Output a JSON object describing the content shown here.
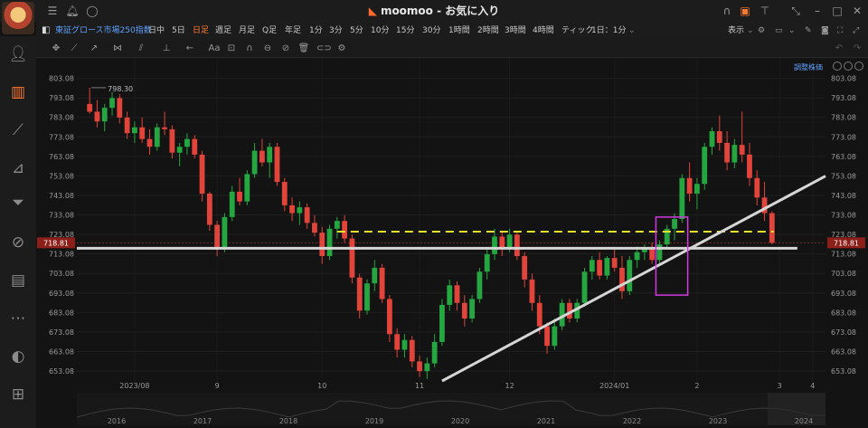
{
  "window": {
    "app_name": "moomoo",
    "title_sep": " - ",
    "subtitle": "お気に入り"
  },
  "toolbar": {
    "symbol": "東証グロース市場250指数",
    "timeframes": [
      "日中",
      "5日",
      "日足",
      "週足",
      "月足",
      "Q足",
      "年足",
      "1分",
      "3分",
      "5分",
      "10分",
      "15分",
      "30分",
      "1時間",
      "2時間",
      "3時間",
      "4時間",
      "ティック",
      "1日：1分"
    ],
    "active_timeframe": "日足",
    "display_label": "表示",
    "adjust_label": "調整株価"
  },
  "icons": {
    "titlebar": [
      "list-icon",
      "bell-icon",
      "chat-icon",
      "headset-icon",
      "lock-icon",
      "shirt-icon",
      "collapse-icon",
      "minimize-icon",
      "maximize-icon",
      "close-icon"
    ],
    "sidebar": [
      "user-icon",
      "chart-icon",
      "trend-icon",
      "report-icon",
      "filter-icon",
      "exchange-icon",
      "news-icon",
      "more-icon",
      "moomoo-icon",
      "gamepad-icon"
    ],
    "drawing_tools": [
      "crosshair-icon",
      "line-icon",
      "ray-icon",
      "pattern-icon",
      "channel-icon",
      "fib-icon",
      "arrow-icon",
      "text-icon",
      "measure-icon",
      "magnet-icon",
      "eraser-icon",
      "hide-icon",
      "trash-icon",
      "toggle-icon",
      "settings-icon"
    ]
  },
  "colors": {
    "up": "#26a641",
    "down": "#e0443a",
    "accent": "#ff7a2c",
    "link": "#5fa0ff",
    "support_line": "#d6d6d6",
    "dashed_line": "#e6e62a",
    "highlight_box": "#d23ae0"
  },
  "chart_data": {
    "type": "candlestick",
    "ylim": [
      648.0,
      808.0
    ],
    "price_ticks": [
      "803.08",
      "793.08",
      "783.08",
      "773.08",
      "763.08",
      "753.08",
      "743.08",
      "733.08",
      "723.08",
      "713.08",
      "703.08",
      "693.08",
      "683.08",
      "673.08",
      "663.08",
      "653.08"
    ],
    "x_labels": [
      "2023/08",
      "9",
      "10",
      "11",
      "12",
      "2024/01",
      "2",
      "3",
      "4"
    ],
    "overview_years": [
      "2016",
      "2017",
      "2018",
      "2019",
      "2020",
      "2021",
      "2022",
      "2023",
      "2024"
    ],
    "current_price": "718.81",
    "high_annotation": "798.30",
    "horizontal_support": 716.0,
    "dashed_resistance": 724.5,
    "candles": [
      {
        "o": 790,
        "h": 798.3,
        "l": 785,
        "c": 786
      },
      {
        "o": 786,
        "h": 792,
        "l": 778,
        "c": 781
      },
      {
        "o": 781,
        "h": 790,
        "l": 776,
        "c": 788
      },
      {
        "o": 788,
        "h": 796,
        "l": 784,
        "c": 793
      },
      {
        "o": 793,
        "h": 795,
        "l": 780,
        "c": 783
      },
      {
        "o": 783,
        "h": 786,
        "l": 772,
        "c": 775
      },
      {
        "o": 775,
        "h": 781,
        "l": 770,
        "c": 778
      },
      {
        "o": 778,
        "h": 783,
        "l": 770,
        "c": 772
      },
      {
        "o": 772,
        "h": 777,
        "l": 764,
        "c": 768
      },
      {
        "o": 768,
        "h": 780,
        "l": 766,
        "c": 778
      },
      {
        "o": 778,
        "h": 786,
        "l": 774,
        "c": 777
      },
      {
        "o": 777,
        "h": 779,
        "l": 762,
        "c": 765
      },
      {
        "o": 765,
        "h": 770,
        "l": 758,
        "c": 768
      },
      {
        "o": 768,
        "h": 775,
        "l": 764,
        "c": 772
      },
      {
        "o": 772,
        "h": 774,
        "l": 762,
        "c": 764
      },
      {
        "o": 764,
        "h": 766,
        "l": 740,
        "c": 744
      },
      {
        "o": 744,
        "h": 745,
        "l": 725,
        "c": 728
      },
      {
        "o": 728,
        "h": 730,
        "l": 712,
        "c": 716
      },
      {
        "o": 716,
        "h": 734,
        "l": 714,
        "c": 732
      },
      {
        "o": 732,
        "h": 748,
        "l": 730,
        "c": 745
      },
      {
        "o": 745,
        "h": 752,
        "l": 738,
        "c": 740
      },
      {
        "o": 740,
        "h": 756,
        "l": 738,
        "c": 754
      },
      {
        "o": 754,
        "h": 770,
        "l": 752,
        "c": 766
      },
      {
        "o": 766,
        "h": 772,
        "l": 758,
        "c": 760
      },
      {
        "o": 760,
        "h": 770,
        "l": 752,
        "c": 768
      },
      {
        "o": 768,
        "h": 770,
        "l": 748,
        "c": 750
      },
      {
        "o": 750,
        "h": 752,
        "l": 735,
        "c": 738
      },
      {
        "o": 738,
        "h": 742,
        "l": 730,
        "c": 734
      },
      {
        "o": 734,
        "h": 740,
        "l": 728,
        "c": 737
      },
      {
        "o": 737,
        "h": 739,
        "l": 726,
        "c": 729
      },
      {
        "o": 729,
        "h": 733,
        "l": 722,
        "c": 724
      },
      {
        "o": 724,
        "h": 727,
        "l": 708,
        "c": 712
      },
      {
        "o": 712,
        "h": 728,
        "l": 710,
        "c": 726
      },
      {
        "o": 726,
        "h": 732,
        "l": 721,
        "c": 730
      },
      {
        "o": 730,
        "h": 733,
        "l": 719,
        "c": 721
      },
      {
        "o": 721,
        "h": 723,
        "l": 698,
        "c": 701
      },
      {
        "o": 701,
        "h": 703,
        "l": 680,
        "c": 684
      },
      {
        "o": 684,
        "h": 700,
        "l": 682,
        "c": 698
      },
      {
        "o": 698,
        "h": 710,
        "l": 694,
        "c": 706
      },
      {
        "o": 706,
        "h": 708,
        "l": 688,
        "c": 690
      },
      {
        "o": 690,
        "h": 692,
        "l": 668,
        "c": 672
      },
      {
        "o": 672,
        "h": 675,
        "l": 660,
        "c": 664
      },
      {
        "o": 664,
        "h": 672,
        "l": 660,
        "c": 669
      },
      {
        "o": 669,
        "h": 671,
        "l": 655,
        "c": 658
      },
      {
        "o": 658,
        "h": 661,
        "l": 650,
        "c": 653
      },
      {
        "o": 653,
        "h": 660,
        "l": 649,
        "c": 657
      },
      {
        "o": 657,
        "h": 672,
        "l": 655,
        "c": 668
      },
      {
        "o": 668,
        "h": 690,
        "l": 666,
        "c": 687
      },
      {
        "o": 687,
        "h": 700,
        "l": 684,
        "c": 697
      },
      {
        "o": 697,
        "h": 699,
        "l": 684,
        "c": 688
      },
      {
        "o": 688,
        "h": 692,
        "l": 676,
        "c": 680
      },
      {
        "o": 680,
        "h": 692,
        "l": 678,
        "c": 690
      },
      {
        "o": 690,
        "h": 706,
        "l": 688,
        "c": 704
      },
      {
        "o": 704,
        "h": 716,
        "l": 700,
        "c": 713
      },
      {
        "o": 713,
        "h": 726,
        "l": 710,
        "c": 722
      },
      {
        "o": 722,
        "h": 725,
        "l": 712,
        "c": 716
      },
      {
        "o": 716,
        "h": 726,
        "l": 714,
        "c": 723
      },
      {
        "o": 723,
        "h": 725,
        "l": 710,
        "c": 712
      },
      {
        "o": 712,
        "h": 714,
        "l": 696,
        "c": 700
      },
      {
        "o": 700,
        "h": 703,
        "l": 684,
        "c": 688
      },
      {
        "o": 688,
        "h": 692,
        "l": 672,
        "c": 676
      },
      {
        "o": 676,
        "h": 678,
        "l": 662,
        "c": 666
      },
      {
        "o": 666,
        "h": 680,
        "l": 664,
        "c": 676
      },
      {
        "o": 676,
        "h": 690,
        "l": 674,
        "c": 688
      },
      {
        "o": 688,
        "h": 690,
        "l": 678,
        "c": 680
      },
      {
        "o": 680,
        "h": 690,
        "l": 678,
        "c": 688
      },
      {
        "o": 688,
        "h": 706,
        "l": 686,
        "c": 704
      },
      {
        "o": 704,
        "h": 712,
        "l": 700,
        "c": 710
      },
      {
        "o": 710,
        "h": 714,
        "l": 700,
        "c": 702
      },
      {
        "o": 702,
        "h": 712,
        "l": 700,
        "c": 711
      },
      {
        "o": 711,
        "h": 716,
        "l": 704,
        "c": 706
      },
      {
        "o": 706,
        "h": 712,
        "l": 690,
        "c": 694
      },
      {
        "o": 694,
        "h": 712,
        "l": 692,
        "c": 710
      },
      {
        "o": 710,
        "h": 717,
        "l": 706,
        "c": 714
      },
      {
        "o": 714,
        "h": 718,
        "l": 710,
        "c": 716
      },
      {
        "o": 716,
        "h": 719,
        "l": 708,
        "c": 710
      },
      {
        "o": 710,
        "h": 720,
        "l": 708,
        "c": 718
      },
      {
        "o": 718,
        "h": 728,
        "l": 716,
        "c": 726
      },
      {
        "o": 726,
        "h": 734,
        "l": 720,
        "c": 731
      },
      {
        "o": 731,
        "h": 754,
        "l": 729,
        "c": 752
      },
      {
        "o": 752,
        "h": 760,
        "l": 740,
        "c": 744
      },
      {
        "o": 744,
        "h": 752,
        "l": 736,
        "c": 749
      },
      {
        "o": 749,
        "h": 770,
        "l": 746,
        "c": 768
      },
      {
        "o": 768,
        "h": 778,
        "l": 764,
        "c": 776
      },
      {
        "o": 776,
        "h": 784,
        "l": 766,
        "c": 770
      },
      {
        "o": 770,
        "h": 776,
        "l": 756,
        "c": 760
      },
      {
        "o": 760,
        "h": 772,
        "l": 757,
        "c": 769
      },
      {
        "o": 769,
        "h": 786,
        "l": 760,
        "c": 764
      },
      {
        "o": 764,
        "h": 770,
        "l": 748,
        "c": 752
      },
      {
        "o": 752,
        "h": 756,
        "l": 738,
        "c": 742
      },
      {
        "o": 742,
        "h": 750,
        "l": 730,
        "c": 734
      },
      {
        "o": 734,
        "h": 735,
        "l": 718,
        "c": 718.81
      }
    ]
  }
}
